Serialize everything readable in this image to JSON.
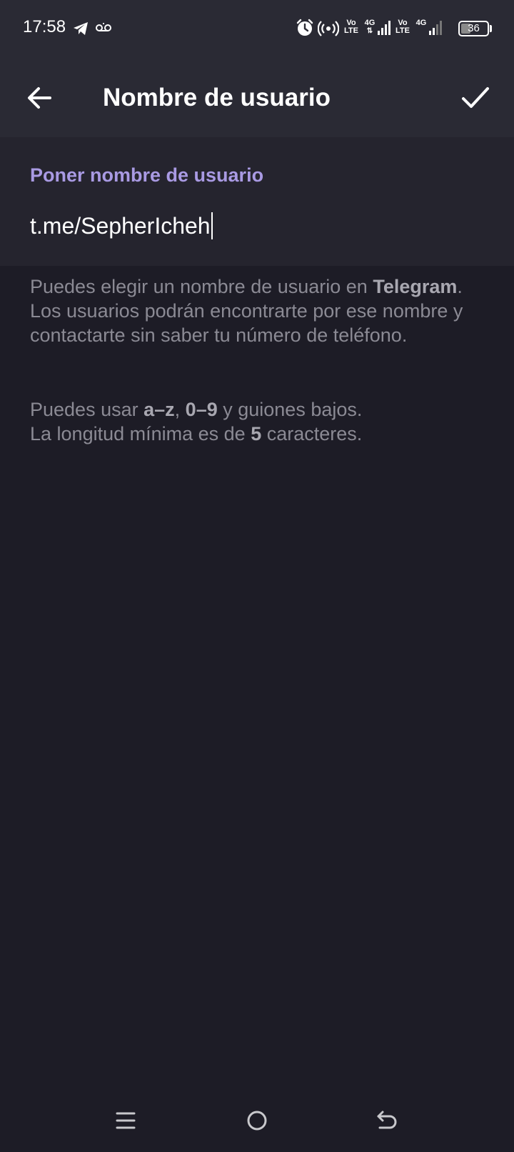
{
  "status_bar": {
    "time": "17:58",
    "icons": [
      "telegram-icon",
      "voicemail-icon",
      "alarm-icon",
      "hotspot-icon",
      "volte-icon",
      "signal-icon",
      "volte-icon",
      "signal-icon"
    ],
    "volte_top": "Vo",
    "volte_bottom": "LTE",
    "network": "4G",
    "battery_percent": "36",
    "battery_level": 0.36
  },
  "app_bar": {
    "title": "Nombre de usuario",
    "back_icon": "arrow-left-icon",
    "done_icon": "checkmark-icon"
  },
  "username_field": {
    "label": "Poner nombre de usuario",
    "value": "t.me/SepherIcheh"
  },
  "help": {
    "p1_a": "Puedes elegir un nombre de usuario en ",
    "p1_bold": "Telegram",
    "p1_b": ". Los usuarios podrán encontrarte por ese nombre y contactarte sin saber tu número de teléfono.",
    "p2_a": "Puedes usar ",
    "p2_bold1": "a–z",
    "p2_sep": ", ",
    "p2_bold2": "0–9",
    "p2_b": " y guiones bajos.",
    "p3_a": "La longitud mínima es de ",
    "p3_bold": "5",
    "p3_b": " caracteres."
  },
  "nav_bar": {
    "icons": [
      "menu-icon",
      "home-icon",
      "back-gesture-icon"
    ]
  },
  "colors": {
    "accent": "#a99ae3",
    "background": "#1d1c26",
    "header": "#2a2a34",
    "input_bg": "#25242e",
    "help_text": "#8b8a94"
  }
}
